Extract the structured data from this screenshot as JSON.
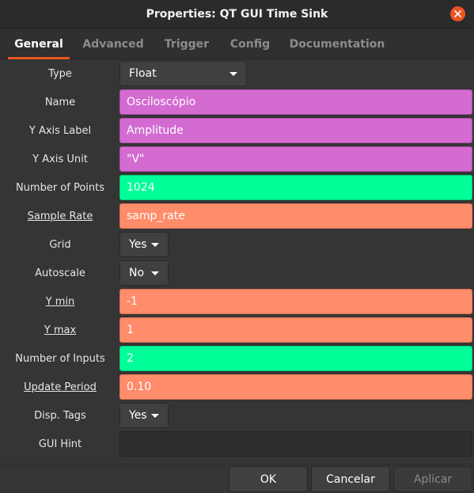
{
  "window": {
    "title": "Properties: QT GUI Time Sink",
    "accent_color": "#e95420"
  },
  "tabs": [
    {
      "label": "General",
      "active": true
    },
    {
      "label": "Advanced",
      "active": false
    },
    {
      "label": "Trigger",
      "active": false
    },
    {
      "label": "Config",
      "active": false
    },
    {
      "label": "Documentation",
      "active": false
    }
  ],
  "fields": {
    "type": {
      "label": "Type",
      "value": "Float"
    },
    "name": {
      "label": "Name",
      "value": "Osciloscópio"
    },
    "y_axis_label": {
      "label": "Y Axis Label",
      "value": "Amplitude"
    },
    "y_axis_unit": {
      "label": "Y Axis Unit",
      "value": "\"V\""
    },
    "number_of_points": {
      "label": "Number of Points",
      "value": "1024"
    },
    "sample_rate": {
      "label": "Sample Rate",
      "value": "samp_rate"
    },
    "grid": {
      "label": "Grid",
      "value": "Yes"
    },
    "autoscale": {
      "label": "Autoscale",
      "value": "No"
    },
    "y_min": {
      "label": "Y min",
      "value": "-1"
    },
    "y_max": {
      "label": "Y max",
      "value": "1"
    },
    "number_of_inputs": {
      "label": "Number of Inputs",
      "value": "2"
    },
    "update_period": {
      "label": "Update Period",
      "value": "0.10"
    },
    "disp_tags": {
      "label": "Disp. Tags",
      "value": "Yes"
    },
    "gui_hint": {
      "label": "GUI Hint",
      "value": ""
    }
  },
  "colors": {
    "string_field": "#d36bd0",
    "int_field": "#00ff99",
    "float_field": "#ff8c6a"
  },
  "footer": {
    "ok_label": "OK",
    "cancel_label": "Cancelar",
    "apply_label": "Aplicar"
  }
}
